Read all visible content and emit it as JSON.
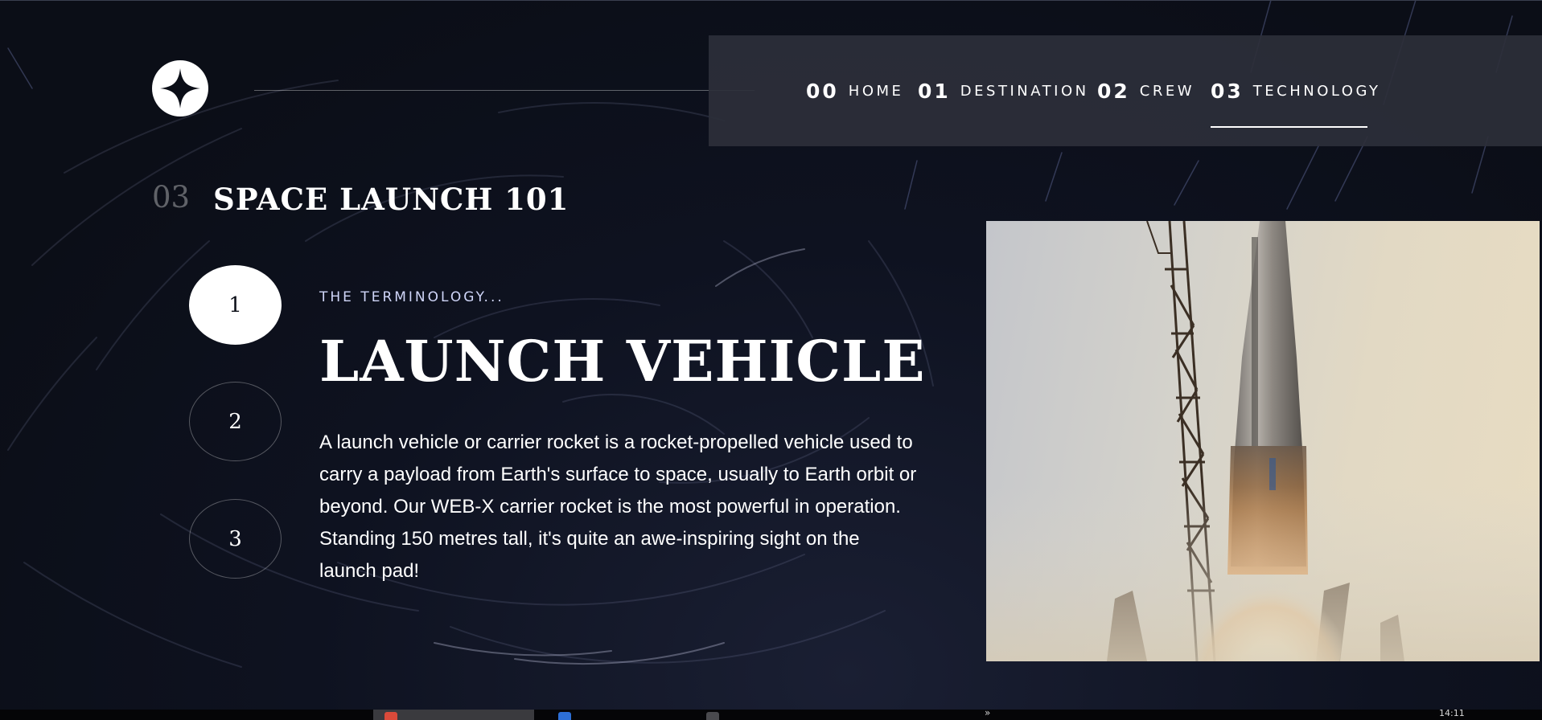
{
  "header": {
    "logo_icon": "star-logo-icon",
    "nav": [
      {
        "num": "00",
        "label": "HOME"
      },
      {
        "num": "01",
        "label": "DESTINATION"
      },
      {
        "num": "02",
        "label": "CREW"
      },
      {
        "num": "03",
        "label": "TECHNOLOGY"
      }
    ],
    "active_index": 3
  },
  "section": {
    "number": "03",
    "title": "SPACE LAUNCH 101"
  },
  "steps": [
    "1",
    "2",
    "3"
  ],
  "active_step": 0,
  "content": {
    "eyebrow": "THE TERMINOLOGY...",
    "term": "LAUNCH VEHICLE",
    "description": "A launch vehicle or carrier rocket is a rocket-propelled vehicle used to carry a payload from Earth's surface to space, usually to Earth orbit or beyond. Our WEB-X carrier rocket is the most powerful in operation. Standing 150 metres tall, it's quite an awe-inspiring sight on the launch pad!"
  },
  "image": {
    "subject": "rocket-launch-photo"
  },
  "taskbar": {
    "chevron": "»",
    "clock": "14:11"
  },
  "colors": {
    "background": "#0b0e17",
    "navbar": "#2c2f3a",
    "accent": "#ffffff",
    "muted": "#d0d6f9"
  }
}
